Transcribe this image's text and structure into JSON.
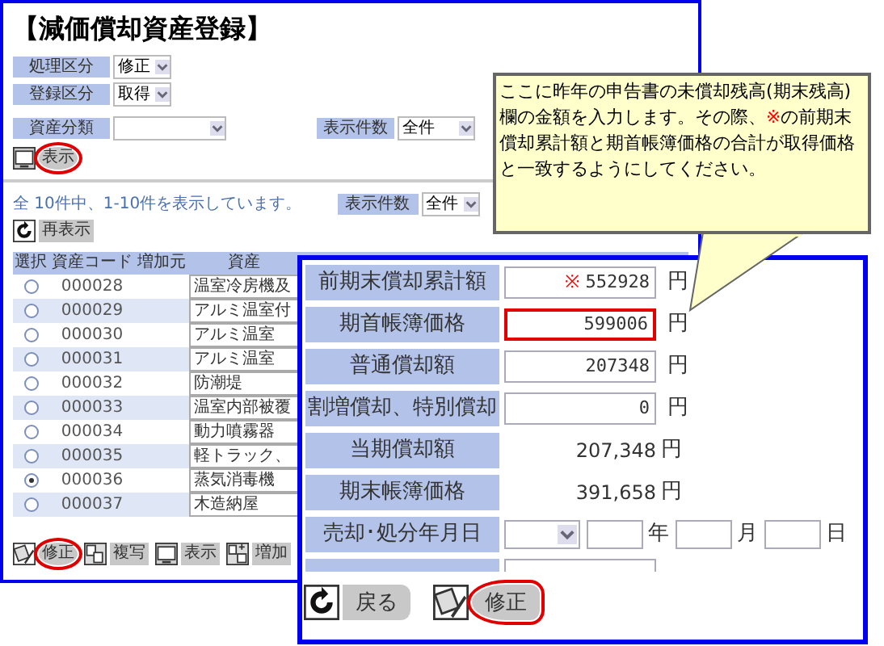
{
  "title": "【減価償却資産登録】",
  "search_fields": [
    {
      "label": "処理区分",
      "value": "修正"
    },
    {
      "label": "登録区分",
      "value": "取得"
    },
    {
      "label": "資産分類"
    }
  ],
  "search_count": {
    "label": "表示件数",
    "value": "全件"
  },
  "show_button": {
    "label": "表示",
    "circled": true
  },
  "result_message": "全 10件中、1-10件を表示しています。",
  "list_count": {
    "label": "表示件数",
    "value": "全件"
  },
  "refresh_button": {
    "label": "再表示"
  },
  "table": {
    "columns": [
      "選択",
      "資産コード",
      "増加元",
      "資産"
    ],
    "rows": [
      {
        "selected": false,
        "code": "000028",
        "name": "温室冷房機及"
      },
      {
        "selected": false,
        "code": "000029",
        "name": "アルミ温室付"
      },
      {
        "selected": false,
        "code": "000030",
        "name": "アルミ温室"
      },
      {
        "selected": false,
        "code": "000031",
        "name": "アルミ温室"
      },
      {
        "selected": false,
        "code": "000032",
        "name": "防潮堤"
      },
      {
        "selected": false,
        "code": "000033",
        "name": "温室内部被覆"
      },
      {
        "selected": false,
        "code": "000034",
        "name": "動力噴霧器"
      },
      {
        "selected": false,
        "code": "000035",
        "name": "軽トラック、"
      },
      {
        "selected": true,
        "code": "000036",
        "name": "蒸気消毒機"
      },
      {
        "selected": false,
        "code": "000037",
        "name": "木造納屋"
      }
    ]
  },
  "actions": [
    {
      "kind": "edit",
      "label": "修正",
      "circled": true
    },
    {
      "kind": "copy",
      "label": "複写",
      "circled": false
    },
    {
      "kind": "show",
      "label": "表示",
      "circled": false
    },
    {
      "kind": "add",
      "label": "増加",
      "circled": false
    }
  ],
  "detail": {
    "rows": [
      {
        "kind": "input",
        "label": "前期末償却累計額",
        "mark": "※",
        "value": "552928",
        "unit": "円",
        "highlighted": false
      },
      {
        "kind": "input",
        "label": "期首帳簿価格",
        "value": "599006",
        "unit": "円",
        "highlighted": true
      },
      {
        "kind": "input",
        "label": "普通償却額",
        "value": "207348",
        "unit": "円",
        "highlighted": false
      },
      {
        "kind": "input",
        "label": "割増償却、特別償却",
        "value": "0",
        "unit": "円",
        "highlighted": false
      },
      {
        "kind": "text",
        "label": "当期償却額",
        "value": "207,348",
        "unit": "円"
      },
      {
        "kind": "text",
        "label": "期末帳簿価格",
        "value": "391,658",
        "unit": "円"
      },
      {
        "kind": "date",
        "label": "売却･処分年月日",
        "units": [
          "年",
          "月",
          "日"
        ]
      },
      {
        "kind": "cut"
      }
    ],
    "buttons": [
      {
        "kind": "back",
        "label": "戻る",
        "circled": false
      },
      {
        "kind": "edit",
        "label": "修正",
        "circled": true
      }
    ]
  },
  "callout": {
    "before": "ここに昨年の申告書の未償却残高(期末残高)欄の金額を入力します。その際、",
    "mark": "※",
    "after": "の前期末償却累計額と期首帳簿価格の合計が取得価格と一致するようにしてください。"
  }
}
